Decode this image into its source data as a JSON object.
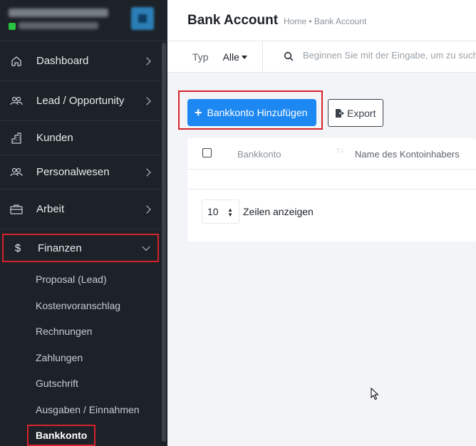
{
  "sidebar": {
    "items": [
      {
        "label": "Dashboard",
        "icon": "home-icon",
        "chevron": true
      },
      {
        "label": "Lead / Opportunity",
        "icon": "users-icon",
        "chevron": true
      },
      {
        "label": "Kunden",
        "icon": "building-icon",
        "chevron": false
      },
      {
        "label": "Personalwesen",
        "icon": "users-icon",
        "chevron": true
      },
      {
        "label": "Arbeit",
        "icon": "briefcase-icon",
        "chevron": true
      },
      {
        "label": "Finanzen",
        "icon": "dollar-icon",
        "chevron": true,
        "expanded": true
      }
    ],
    "finanzen_icon_glyph": "$",
    "sub_items": [
      "Proposal (Lead)",
      "Kostenvoranschlag",
      "Rechnungen",
      "Zahlungen",
      "Gutschrift",
      "Ausgaben / Einnahmen",
      "Bankkonto"
    ]
  },
  "header": {
    "title": "Bank Account",
    "breadcrumb": "Home • Bank Account"
  },
  "filter": {
    "type_label": "Typ",
    "type_value": "Alle",
    "search_placeholder": "Beginnen Sie mit der Eingabe, um zu suchen"
  },
  "actions": {
    "add_label": "Bankkonto Hinzufügen",
    "add_plus": "+",
    "export_label": "Export"
  },
  "table": {
    "columns": [
      "Bankkonto",
      "Name des Kontoinhabers"
    ],
    "sort_glyph": "↑↓",
    "page_length": "10",
    "page_length_label": "Zeilen anzeigen"
  },
  "colors": {
    "sidebar_bg": "#1d2228",
    "primary": "#1e88f2",
    "highlight": "#d7222b"
  }
}
